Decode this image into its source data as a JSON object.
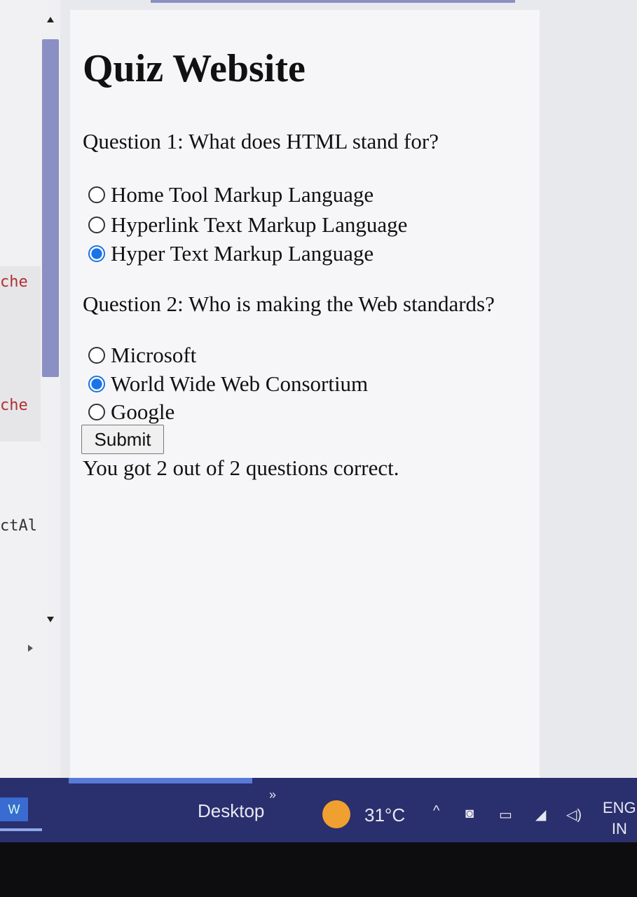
{
  "editor_snippets": [
    "che",
    "che",
    "ctAl"
  ],
  "page": {
    "title": "Quiz Website"
  },
  "questions": [
    {
      "text": "Question 1: What does HTML stand for?",
      "options": [
        {
          "label": "Home Tool Markup Language",
          "checked": false
        },
        {
          "label": "Hyperlink Text Markup Language",
          "checked": false
        },
        {
          "label": "Hyper Text Markup Language",
          "checked": true
        }
      ]
    },
    {
      "text": "Question 2: Who is making the Web standards?",
      "options": [
        {
          "label": "Microsoft",
          "checked": false
        },
        {
          "label": "World Wide Web Consortium",
          "checked": true
        },
        {
          "label": "Google",
          "checked": false
        }
      ]
    }
  ],
  "submit_label": "Submit",
  "result_text": "You got 2 out of 2 questions correct.",
  "taskbar": {
    "app_icon_text": "W",
    "desktop_label": "Desktop",
    "chevrons": "»",
    "weather_icon": "weather-sun-icon",
    "temperature": "31°C",
    "tray_chevron": "^",
    "language": "ENG",
    "region": "IN"
  },
  "colors": {
    "accent": "#1a73e8",
    "scroll_thumb": "#8a8fc4",
    "taskbar": "#2a2f6e"
  }
}
